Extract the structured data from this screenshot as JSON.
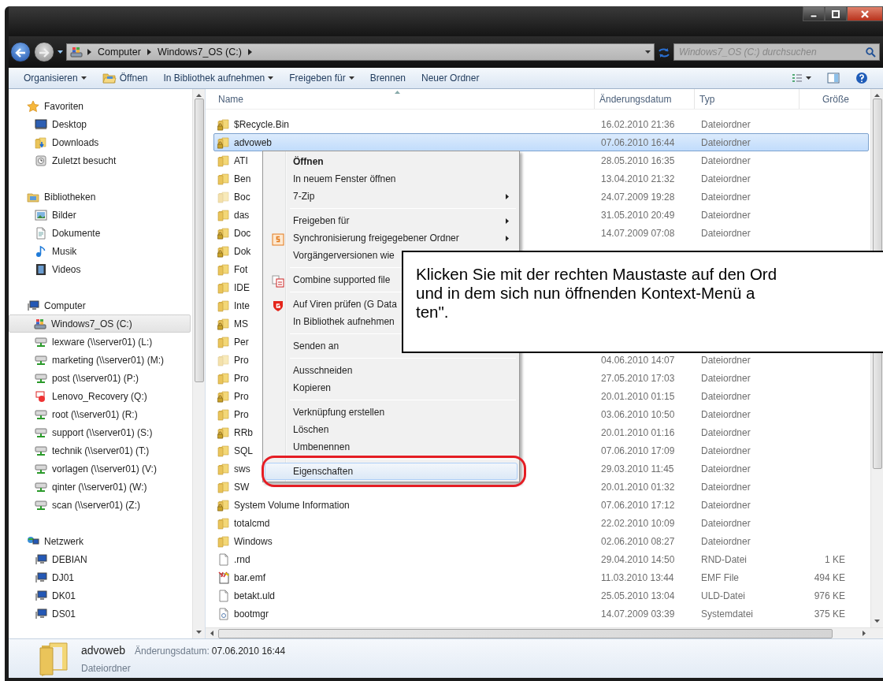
{
  "address": {
    "crumbs": [
      "Computer",
      "Windows7_OS (C:)"
    ],
    "search_placeholder": "Windows7_OS (C:) durchsuchen"
  },
  "toolbar": [
    {
      "label": "Organisieren",
      "kind": "dropdown"
    },
    {
      "label": "Öffnen",
      "kind": "icon"
    },
    {
      "label": "In Bibliothek aufnehmen",
      "kind": "dropdown"
    },
    {
      "label": "Freigeben für",
      "kind": "dropdown"
    },
    {
      "label": "Brennen",
      "kind": "plain"
    },
    {
      "label": "Neuer Ordner",
      "kind": "plain"
    }
  ],
  "nav": [
    {
      "label": "Favoriten",
      "kind": "star",
      "items": [
        {
          "label": "Desktop",
          "kind": "desktop",
          "selected": false
        },
        {
          "label": "Downloads",
          "kind": "downloads",
          "selected": false
        },
        {
          "label": "Zuletzt besucht",
          "kind": "recent",
          "selected": false
        }
      ]
    },
    {
      "label": "Bibliotheken",
      "kind": "libraries",
      "items": [
        {
          "label": "Bilder",
          "kind": "pictures",
          "selected": false
        },
        {
          "label": "Dokumente",
          "kind": "documents",
          "selected": false
        },
        {
          "label": "Musik",
          "kind": "music",
          "selected": false
        },
        {
          "label": "Videos",
          "kind": "videos",
          "selected": false
        }
      ]
    },
    {
      "label": "Computer",
      "kind": "computer",
      "items": [
        {
          "label": "Windows7_OS (C:)",
          "kind": "drive",
          "selected": true
        },
        {
          "label": "lexware (\\\\server01) (L:)",
          "kind": "netdrive",
          "selected": false
        },
        {
          "label": "marketing (\\\\server01) (M:)",
          "kind": "netdrive",
          "selected": false
        },
        {
          "label": "post (\\\\server01) (P:)",
          "kind": "netdrive",
          "selected": false
        },
        {
          "label": "Lenovo_Recovery (Q:)",
          "kind": "recovery",
          "selected": false
        },
        {
          "label": "root (\\\\server01) (R:)",
          "kind": "netdrive",
          "selected": false
        },
        {
          "label": "support (\\\\server01) (S:)",
          "kind": "netdrive",
          "selected": false
        },
        {
          "label": "technik (\\\\server01) (T:)",
          "kind": "netdrive",
          "selected": false
        },
        {
          "label": "vorlagen (\\\\server01) (V:)",
          "kind": "netdrive",
          "selected": false
        },
        {
          "label": "qinter (\\\\server01) (W:)",
          "kind": "netdrive",
          "selected": false
        },
        {
          "label": "scan (\\\\server01) (Z:)",
          "kind": "netdrive",
          "selected": false
        }
      ]
    },
    {
      "label": "Netzwerk",
      "kind": "network",
      "items": [
        {
          "label": "DEBIAN",
          "kind": "pc",
          "selected": false
        },
        {
          "label": "DJ01",
          "kind": "pc",
          "selected": false
        },
        {
          "label": "DK01",
          "kind": "pc",
          "selected": false
        },
        {
          "label": "DS01",
          "kind": "pc",
          "selected": false
        }
      ]
    }
  ],
  "columns": [
    "Name",
    "Änderungsdatum",
    "Typ",
    "Größe"
  ],
  "rows": [
    {
      "name": "$Recycle.Bin",
      "date": "16.02.2010 21:36",
      "type": "Dateiordner",
      "kind": "locked_folder",
      "selected": false
    },
    {
      "name": "advoweb",
      "date": "07.06.2010 16:44",
      "type": "Dateiordner",
      "kind": "locked_folder",
      "selected": true
    },
    {
      "name": "ATI",
      "date": "28.05.2010 16:35",
      "type": "Dateiordner",
      "kind": "folder",
      "selected": false
    },
    {
      "name": "Ben",
      "date": "13.04.2010 21:32",
      "type": "Dateiordner",
      "kind": "folder",
      "selected": false
    },
    {
      "name": "Boc",
      "date": "24.07.2009 19:28",
      "type": "Dateiordner",
      "kind": "hidden_folder",
      "selected": false
    },
    {
      "name": "das",
      "date": "31.05.2010 20:49",
      "type": "Dateiordner",
      "kind": "folder",
      "selected": false
    },
    {
      "name": "Doc",
      "date": "14.07.2009 07:08",
      "type": "Dateiordner",
      "kind": "locked_folder",
      "selected": false
    },
    {
      "name": "Dok",
      "kind": "locked_folder",
      "selected": false
    },
    {
      "name": "Fot",
      "kind": "folder",
      "selected": false
    },
    {
      "name": "IDE",
      "kind": "folder",
      "selected": false
    },
    {
      "name": "Inte",
      "kind": "folder",
      "selected": false
    },
    {
      "name": "MS",
      "kind": "locked_folder",
      "selected": false
    },
    {
      "name": "Per",
      "kind": "folder",
      "selected": false
    },
    {
      "name": "Pro",
      "date": "04.06.2010 14:07",
      "type": "Dateiordner",
      "kind": "hidden_folder",
      "selected": false
    },
    {
      "name": "Pro",
      "date": "27.05.2010 17:03",
      "type": "Dateiordner",
      "kind": "folder",
      "selected": false
    },
    {
      "name": "Pro",
      "date": "20.01.2010 01:15",
      "type": "Dateiordner",
      "kind": "locked_folder",
      "selected": false
    },
    {
      "name": "Pro",
      "date": "03.06.2010 10:50",
      "type": "Dateiordner",
      "kind": "folder",
      "selected": false
    },
    {
      "name": "RRb",
      "date": "20.01.2010 01:16",
      "type": "Dateiordner",
      "kind": "locked_folder",
      "selected": false
    },
    {
      "name": "SQL",
      "date": "07.06.2010 17:09",
      "type": "Dateiordner",
      "kind": "folder",
      "selected": false
    },
    {
      "name": "sws",
      "date": "29.03.2010 11:45",
      "type": "Dateiordner",
      "kind": "folder",
      "selected": false
    },
    {
      "name": "SW",
      "date": "20.01.2010 01:32",
      "type": "Dateiordner",
      "kind": "folder",
      "selected": false
    },
    {
      "name": "System Volume Information",
      "date": "07.06.2010 17:12",
      "type": "Dateiordner",
      "kind": "locked_folder",
      "selected": false
    },
    {
      "name": "totalcmd",
      "date": "22.02.2010 10:09",
      "type": "Dateiordner",
      "kind": "folder",
      "selected": false
    },
    {
      "name": "Windows",
      "date": "02.06.2010 08:27",
      "type": "Dateiordner",
      "kind": "folder",
      "selected": false
    },
    {
      "name": ".rnd",
      "date": "29.04.2010 14:50",
      "type": "RND-Datei",
      "size": "1 KE",
      "kind": "file",
      "selected": false
    },
    {
      "name": "bar.emf",
      "date": "11.03.2010 13:44",
      "type": "EMF File",
      "size": "494 KE",
      "kind": "image_file",
      "selected": false
    },
    {
      "name": "betakt.uld",
      "date": "25.05.2010 13:04",
      "type": "ULD-Datei",
      "size": "976 KE",
      "kind": "file",
      "selected": false
    },
    {
      "name": "bootmgr",
      "date": "14.07.2009 03:39",
      "type": "Systemdatei",
      "size": "375 KE",
      "kind": "system_file",
      "selected": false
    }
  ],
  "context_menu": [
    {
      "kind": "item",
      "label": "Öffnen",
      "default": true,
      "submenu": false,
      "selected": false
    },
    {
      "kind": "item",
      "label": "In neuem Fenster öffnen",
      "submenu": false,
      "selected": false
    },
    {
      "kind": "item",
      "label": "7-Zip",
      "submenu": true,
      "selected": false
    },
    {
      "kind": "separator"
    },
    {
      "kind": "item",
      "label": "Freigeben für",
      "submenu": true,
      "selected": false
    },
    {
      "kind": "sync",
      "label": "Synchronisierung freigegebener Ordner",
      "submenu": true,
      "selected": false
    },
    {
      "kind": "item",
      "label": "Vorgängerversionen wie",
      "selected": false
    },
    {
      "kind": "separator"
    },
    {
      "kind": "pdf",
      "label": "Combine supported file",
      "selected": false
    },
    {
      "kind": "separator"
    },
    {
      "kind": "antivirus",
      "label": "Auf Viren prüfen (G Data",
      "selected": false
    },
    {
      "kind": "item",
      "label": "In Bibliothek aufnehmen",
      "selected": false
    },
    {
      "kind": "separator"
    },
    {
      "kind": "item",
      "label": "Senden an",
      "selected": false
    },
    {
      "kind": "separator"
    },
    {
      "kind": "item",
      "label": "Ausschneiden",
      "submenu": false,
      "selected": false
    },
    {
      "kind": "item",
      "label": "Kopieren",
      "submenu": false,
      "selected": false
    },
    {
      "kind": "separator"
    },
    {
      "kind": "item",
      "label": "Verknüpfung erstellen",
      "submenu": false,
      "selected": false
    },
    {
      "kind": "item",
      "label": "Löschen",
      "submenu": false,
      "selected": false
    },
    {
      "kind": "item",
      "label": "Umbenennen",
      "submenu": false,
      "selected": false
    },
    {
      "kind": "separator"
    },
    {
      "kind": "item",
      "label": "Eigenschaften",
      "submenu": false,
      "selected": true,
      "highlighted": true
    }
  ],
  "callout": {
    "lines": [
      "Klicken Sie mit der rechten Maustaste auf den Ord",
      "und in dem sich nun öffnenden Kontext-Menü a",
      "ten\"."
    ]
  },
  "details": {
    "name": "advoweb",
    "date_label": "Änderungsdatum:",
    "date": "07.06.2010 16:44",
    "type": "Dateiordner"
  }
}
